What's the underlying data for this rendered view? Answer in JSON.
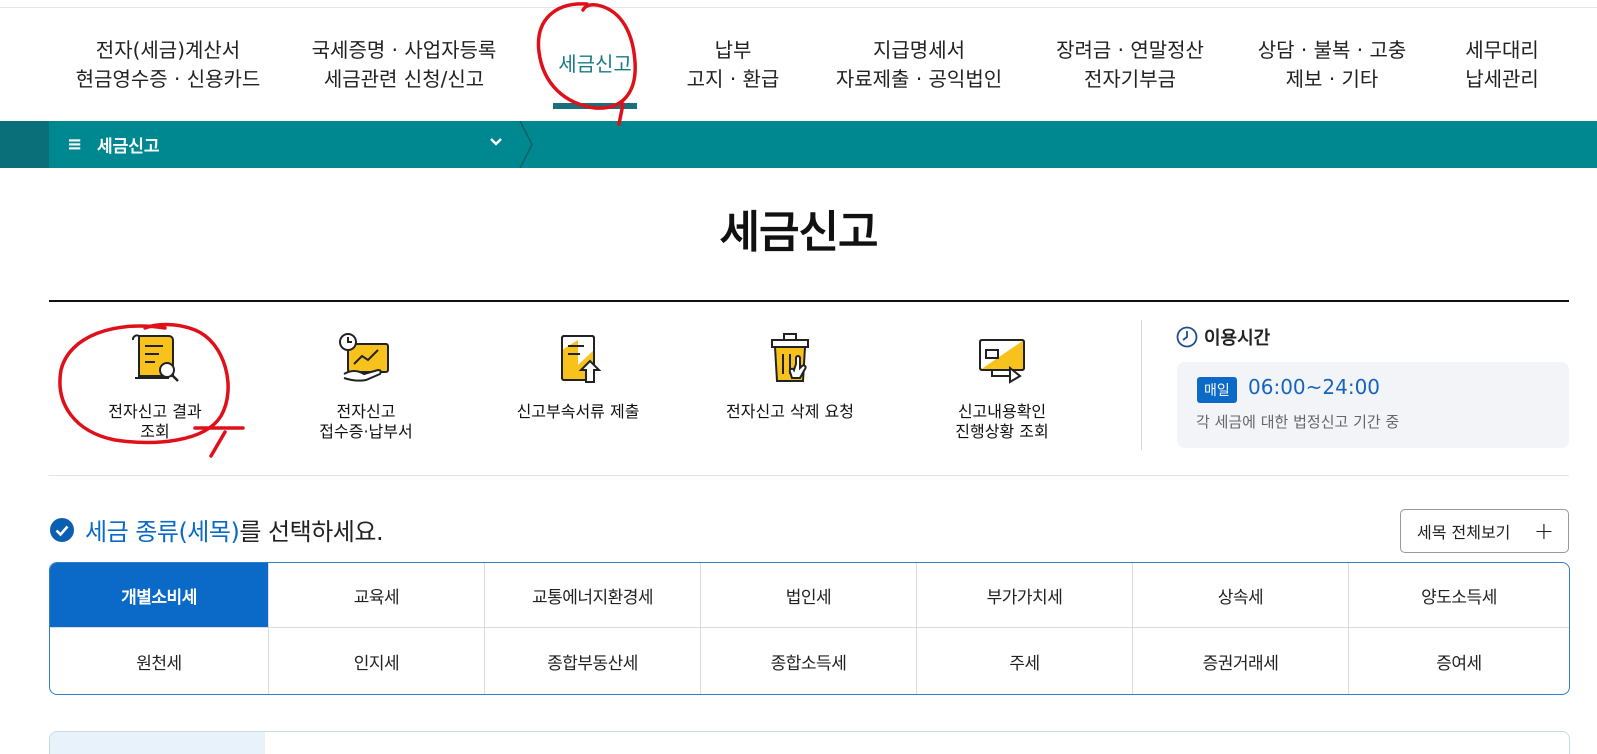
{
  "gnb": [
    {
      "line1": "전자(세금)계산서",
      "line2": "현금영수증 · 신용카드"
    },
    {
      "line1": "국세증명 · 사업자등록",
      "line2": "세금관련 신청/신고"
    },
    {
      "line1": "세금신고",
      "line2": ""
    },
    {
      "line1": "납부",
      "line2": "고지 · 환급"
    },
    {
      "line1": "지급명세서",
      "line2": "자료제출 · 공익법인"
    },
    {
      "line1": "장려금 · 연말정산",
      "line2": "전자기부금"
    },
    {
      "line1": "상담 · 불복 · 고충",
      "line2": "제보 · 기타"
    },
    {
      "line1": "세무대리",
      "line2": "납세관리"
    }
  ],
  "locbar": {
    "menu_icon": "≡",
    "label": "세금신고",
    "chevron": "⌄"
  },
  "page_title": "세금신고",
  "quick_menu": [
    {
      "icon": "document-search-icon",
      "line1": "전자신고 결과",
      "line2": "조회"
    },
    {
      "icon": "receipt-chart-icon",
      "line1": "전자신고",
      "line2": "접수증·납부서"
    },
    {
      "icon": "document-upload-icon",
      "line1": "신고부속서류 제출",
      "line2": ""
    },
    {
      "icon": "trash-delete-icon",
      "line1": "전자신고 삭제 요청",
      "line2": ""
    },
    {
      "icon": "monitor-check-icon",
      "line1": "신고내용확인",
      "line2": "진행상황 조회"
    }
  ],
  "usage": {
    "title": "이용시간",
    "badge": "매일",
    "time": "06:00~24:00",
    "desc": "각 세금에 대한 법정신고 기간 중"
  },
  "select_section": {
    "title_blue": "세금 종류(세목)",
    "title_rest": "를 선택하세요.",
    "all_button": "세목 전체보기",
    "all_button_icon": "+"
  },
  "tax_types": [
    "개별소비세",
    "교육세",
    "교통에너지환경세",
    "법인세",
    "부가가치세",
    "상속세",
    "양도소득세",
    "원천세",
    "인지세",
    "종합부동산세",
    "종합소득세",
    "주세",
    "증권거래세",
    "증여세"
  ],
  "colors": {
    "teal": "#008891",
    "blue": "#0b69c7",
    "annotation": "#e0101a"
  }
}
